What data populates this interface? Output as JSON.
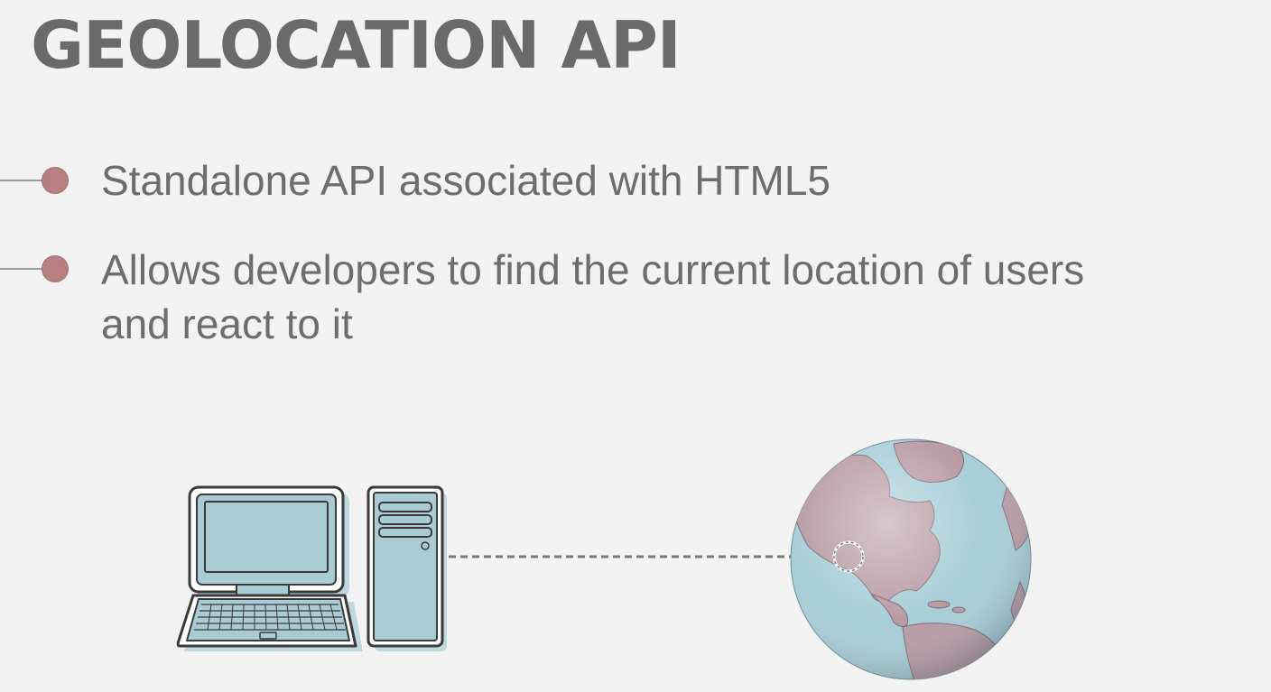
{
  "slide": {
    "title": "GEOLOCATION API",
    "bullets": [
      {
        "line1": "Standalone API associated with HTML5"
      },
      {
        "line1": "Allows developers to find the current location of users",
        "line2": "and react to it"
      }
    ]
  },
  "illustration": {
    "icons": [
      "computer-icon",
      "globe-icon"
    ],
    "colors": {
      "device_fill": "#a9ccd4",
      "device_stroke": "#3a3a3a",
      "globe_ocean": "#a7cdd6",
      "globe_land": "#b79aa4",
      "bullet": "#b87f82"
    }
  }
}
